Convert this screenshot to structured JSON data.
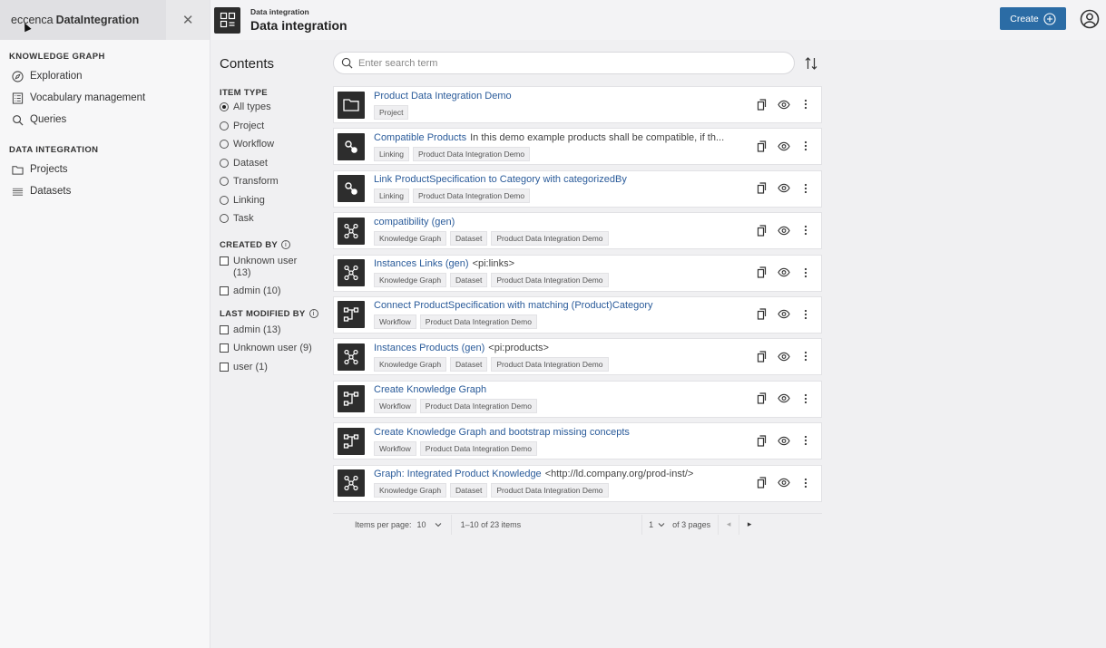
{
  "sidebar": {
    "brand_prefix": "eccenca",
    "brand_name": "DataIntegration",
    "close_icon": "close-icon",
    "sections": [
      {
        "title": "KNOWLEDGE GRAPH",
        "items": [
          {
            "label": "Exploration",
            "icon": "compass-icon"
          },
          {
            "label": "Vocabulary management",
            "icon": "list-icon"
          },
          {
            "label": "Queries",
            "icon": "search-icon"
          }
        ]
      },
      {
        "title": "DATA INTEGRATION",
        "items": [
          {
            "label": "Projects",
            "icon": "folder-icon"
          },
          {
            "label": "Datasets",
            "icon": "dataset-icon"
          }
        ]
      }
    ]
  },
  "header": {
    "app_small": "Data integration",
    "app_title": "Data integration",
    "create_label": "Create",
    "accent": "#2b6ca5"
  },
  "main": {
    "title": "Contents",
    "search_placeholder": "Enter search term"
  },
  "filters": {
    "item_type": {
      "title": "ITEM TYPE",
      "options": [
        "All types",
        "Project",
        "Workflow",
        "Dataset",
        "Transform",
        "Linking",
        "Task"
      ],
      "selected": "All types"
    },
    "created_by": {
      "title": "CREATED BY",
      "options": [
        "Unknown user (13)",
        "admin (10)"
      ]
    },
    "last_modified_by": {
      "title": "LAST MODIFIED BY",
      "options": [
        "admin (13)",
        "Unknown user (9)",
        "user (1)"
      ]
    }
  },
  "items": [
    {
      "title": "Product Data Integration Demo",
      "desc": "",
      "icon": "folder-icon",
      "tags": [
        "Project"
      ]
    },
    {
      "title": "Compatible Products",
      "desc": "In this demo example products shall be compatible, if th...",
      "icon": "linking-icon",
      "tags": [
        "Linking",
        "Product Data Integration Demo"
      ]
    },
    {
      "title": "Link ProductSpecification to Category with categorizedBy",
      "desc": "",
      "icon": "linking-icon",
      "tags": [
        "Linking",
        "Product Data Integration Demo"
      ]
    },
    {
      "title": "compatibility (gen)",
      "desc": "",
      "icon": "graph-icon",
      "tags": [
        "Knowledge Graph",
        "Dataset",
        "Product Data Integration Demo"
      ]
    },
    {
      "title": "Instances Links (gen)",
      "desc": "<pi:links>",
      "icon": "graph-icon",
      "tags": [
        "Knowledge Graph",
        "Dataset",
        "Product Data Integration Demo"
      ]
    },
    {
      "title": "Connect ProductSpecification with matching (Product)Category",
      "desc": "",
      "icon": "workflow-icon",
      "tags": [
        "Workflow",
        "Product Data Integration Demo"
      ]
    },
    {
      "title": "Instances Products (gen)",
      "desc": "<pi:products>",
      "icon": "graph-icon",
      "tags": [
        "Knowledge Graph",
        "Dataset",
        "Product Data Integration Demo"
      ]
    },
    {
      "title": "Create Knowledge Graph",
      "desc": "",
      "icon": "workflow-icon",
      "tags": [
        "Workflow",
        "Product Data Integration Demo"
      ]
    },
    {
      "title": "Create Knowledge Graph and bootstrap missing concepts",
      "desc": "",
      "icon": "workflow-icon",
      "tags": [
        "Workflow",
        "Product Data Integration Demo"
      ]
    },
    {
      "title": "Graph: Integrated Product Knowledge",
      "desc": "<http://ld.company.org/prod-inst/>",
      "icon": "graph-icon",
      "tags": [
        "Knowledge Graph",
        "Dataset",
        "Product Data Integration Demo"
      ]
    }
  ],
  "pagination": {
    "per_page_label": "Items per page:",
    "per_page": "10",
    "range": "1–10 of 23 items",
    "page": "1",
    "of_pages": "of 3 pages"
  }
}
